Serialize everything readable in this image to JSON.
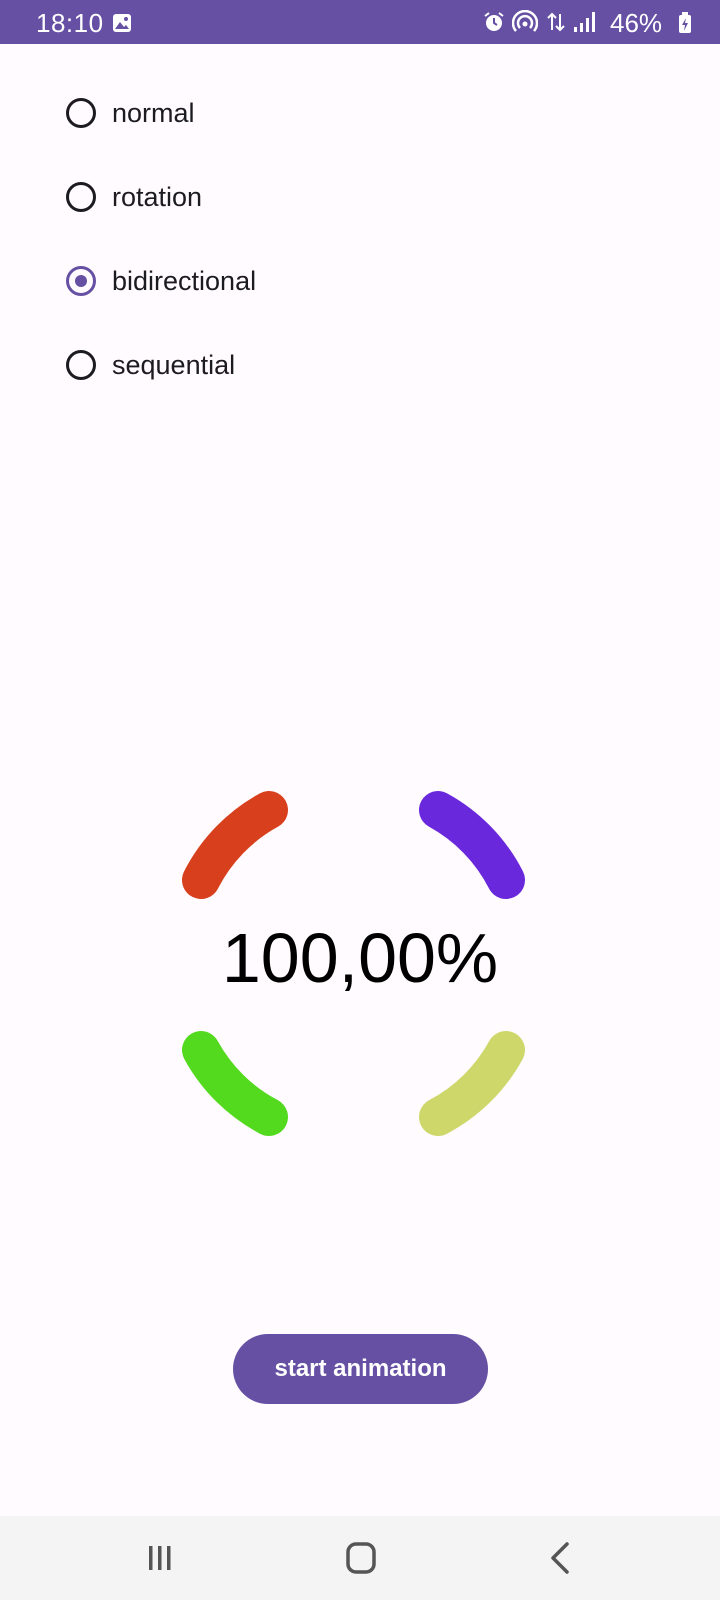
{
  "status_bar": {
    "time": "18:10",
    "battery_text": "46%",
    "icons": [
      "gallery-icon",
      "alarm-icon",
      "hotspot-icon",
      "data-icon",
      "signal-icon",
      "battery-icon"
    ]
  },
  "radio_group": {
    "options": [
      {
        "label": "normal",
        "selected": false
      },
      {
        "label": "rotation",
        "selected": false
      },
      {
        "label": "bidirectional",
        "selected": true
      },
      {
        "label": "sequential",
        "selected": false
      }
    ]
  },
  "progress": {
    "text": "100,00%",
    "value_percent": 100,
    "arc_colors": {
      "top_left": "#d8401d",
      "top_right": "#6a28dc",
      "bottom_right": "#cdd76a",
      "bottom_left": "#53d91e"
    }
  },
  "actions": {
    "start_label": "start animation"
  },
  "navigation": {
    "icons": [
      "recent-apps-icon",
      "home-icon",
      "back-icon"
    ]
  },
  "theme": {
    "primary": "#6650a4",
    "background": "#fffbfe"
  }
}
